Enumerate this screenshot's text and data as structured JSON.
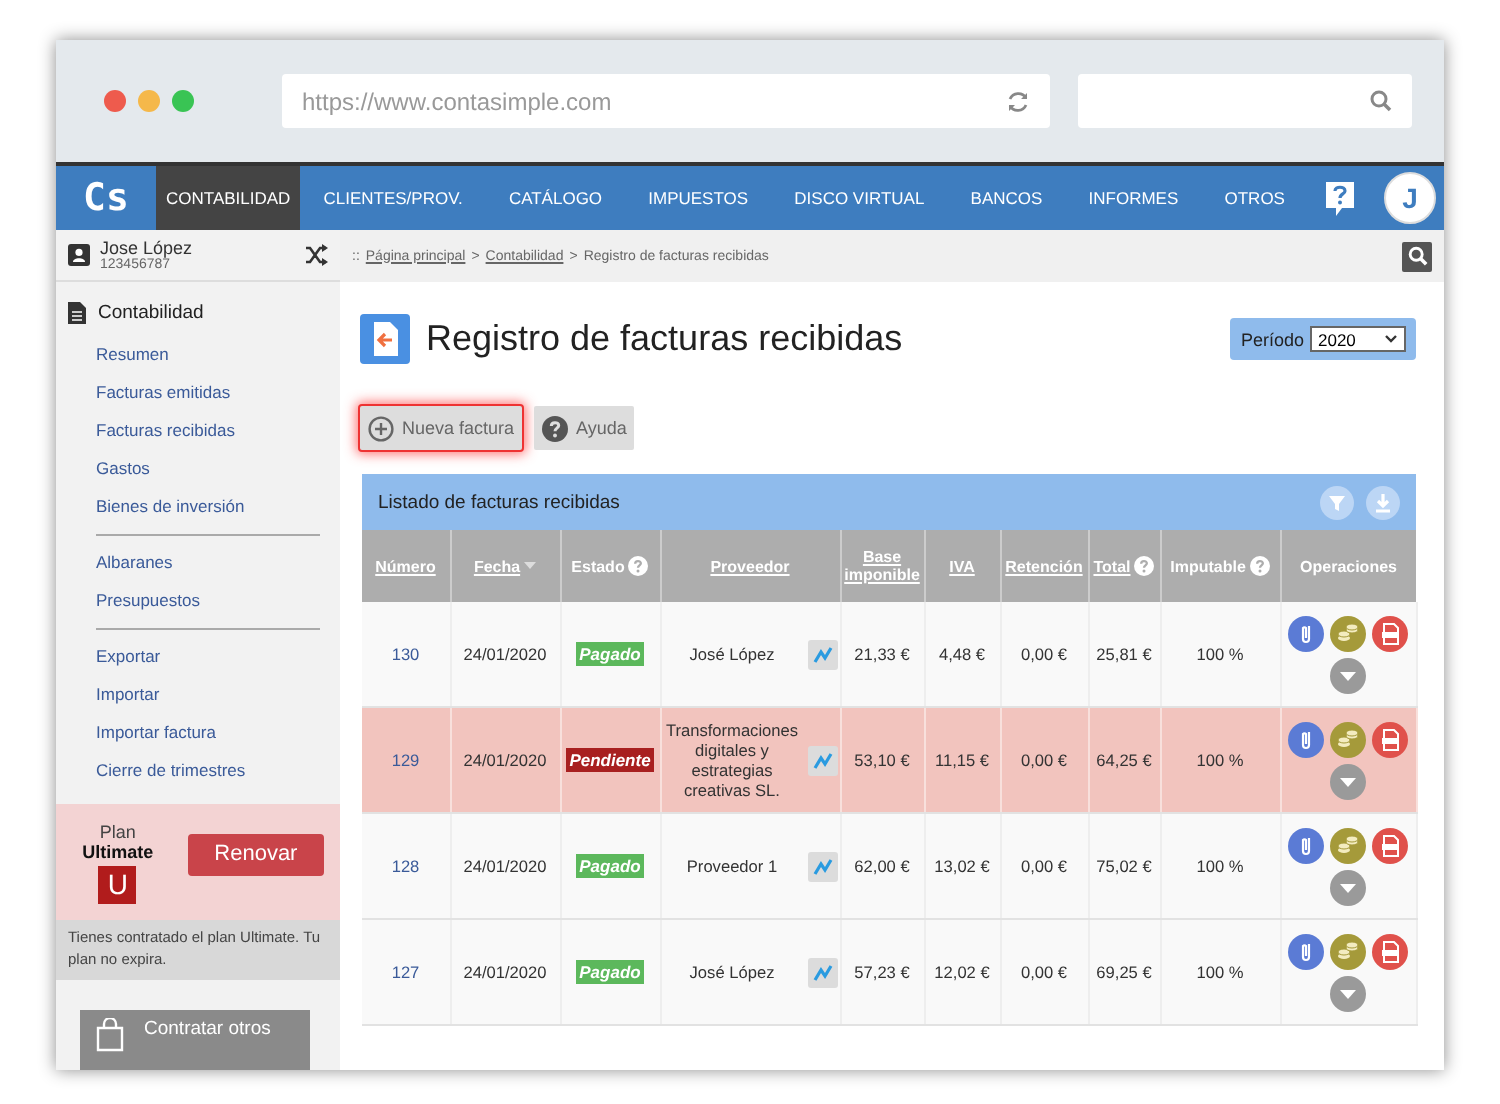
{
  "browser": {
    "url": "https://www.contasimple.com"
  },
  "nav": {
    "logo": "Cs",
    "avatar": "J",
    "tabs": [
      {
        "label": "CONTABILIDAD",
        "selected": true
      },
      {
        "label": "CLIENTES/PROV.",
        "selected": false
      },
      {
        "label": "CATÁLOGO",
        "selected": false
      },
      {
        "label": "IMPUESTOS",
        "selected": false
      },
      {
        "label": "DISCO VIRTUAL",
        "selected": false
      },
      {
        "label": "BANCOS",
        "selected": false
      },
      {
        "label": "INFORMES",
        "selected": false
      },
      {
        "label": "OTROS",
        "selected": false
      }
    ]
  },
  "user": {
    "name": "Jose López",
    "id": "123456787"
  },
  "sidebar": {
    "section": "Contabilidad",
    "groups": [
      [
        "Resumen",
        "Facturas emitidas",
        "Facturas recibidas",
        "Gastos",
        "Bienes de inversión"
      ],
      [
        "Albaranes",
        "Presupuestos"
      ],
      [
        "Exportar",
        "Importar",
        "Importar factura",
        "Cierre de trimestres"
      ]
    ]
  },
  "plan": {
    "label": "Plan",
    "name": "Ultimate",
    "badge": "U",
    "button": "Renovar",
    "note": "Tienes contratado el plan Ultimate. Tu plan no expira.",
    "extra_button": "Contratar otros"
  },
  "breadcrumb": {
    "prefix": "::",
    "separator": ">",
    "items": [
      {
        "label": "Página principal",
        "link": true
      },
      {
        "label": "Contabilidad",
        "link": true
      },
      {
        "label": "Registro de facturas recibidas",
        "link": false
      }
    ]
  },
  "page": {
    "title": "Registro de facturas recibidas",
    "period": {
      "label": "Período",
      "value": "2020"
    },
    "buttons": [
      {
        "label": "Nueva factura",
        "kind": "add",
        "highlighted": true
      },
      {
        "label": "Ayuda",
        "kind": "help",
        "highlighted": false
      }
    ]
  },
  "table": {
    "title": "Listado de facturas recibidas",
    "columns": [
      {
        "label": "Número",
        "sortable": true,
        "help": false,
        "sorted": false
      },
      {
        "label": "Fecha",
        "sortable": true,
        "help": false,
        "sorted": true
      },
      {
        "label": "Estado",
        "sortable": false,
        "help": true,
        "sorted": false
      },
      {
        "label": "Proveedor",
        "sortable": true,
        "help": false,
        "sorted": false
      },
      {
        "label": "Base imponible",
        "sortable": true,
        "help": false,
        "sorted": false
      },
      {
        "label": "IVA",
        "sortable": true,
        "help": false,
        "sorted": false
      },
      {
        "label": "Retención",
        "sortable": true,
        "help": false,
        "sorted": false
      },
      {
        "label": "Total",
        "sortable": true,
        "help": true,
        "sorted": false
      },
      {
        "label": "Imputable",
        "sortable": false,
        "help": true,
        "sorted": false
      },
      {
        "label": "Operaciones",
        "sortable": false,
        "help": false,
        "sorted": false
      }
    ],
    "rows": [
      {
        "number": "130",
        "date": "24/01/2020",
        "status": {
          "label": "Pagado",
          "kind": "paid"
        },
        "supplier": "José López",
        "base": "21,33 €",
        "iva": "4,48 €",
        "retention": "0,00 €",
        "total": "25,81 €",
        "imputable": "100 %"
      },
      {
        "number": "129",
        "date": "24/01/2020",
        "status": {
          "label": "Pendiente",
          "kind": "pending"
        },
        "supplier": "Transformaciones digitales y estrategias creativas SL.",
        "base": "53,10 €",
        "iva": "11,15 €",
        "retention": "0,00 €",
        "total": "64,25 €",
        "imputable": "100 %"
      },
      {
        "number": "128",
        "date": "24/01/2020",
        "status": {
          "label": "Pagado",
          "kind": "paid"
        },
        "supplier": "Proveedor 1",
        "base": "62,00 €",
        "iva": "13,02 €",
        "retention": "0,00 €",
        "total": "75,02 €",
        "imputable": "100 %"
      },
      {
        "number": "127",
        "date": "24/01/2020",
        "status": {
          "label": "Pagado",
          "kind": "paid"
        },
        "supplier": "José López",
        "base": "57,23 €",
        "iva": "12,02 €",
        "retention": "0,00 €",
        "total": "69,25 €",
        "imputable": "100 %"
      }
    ]
  }
}
